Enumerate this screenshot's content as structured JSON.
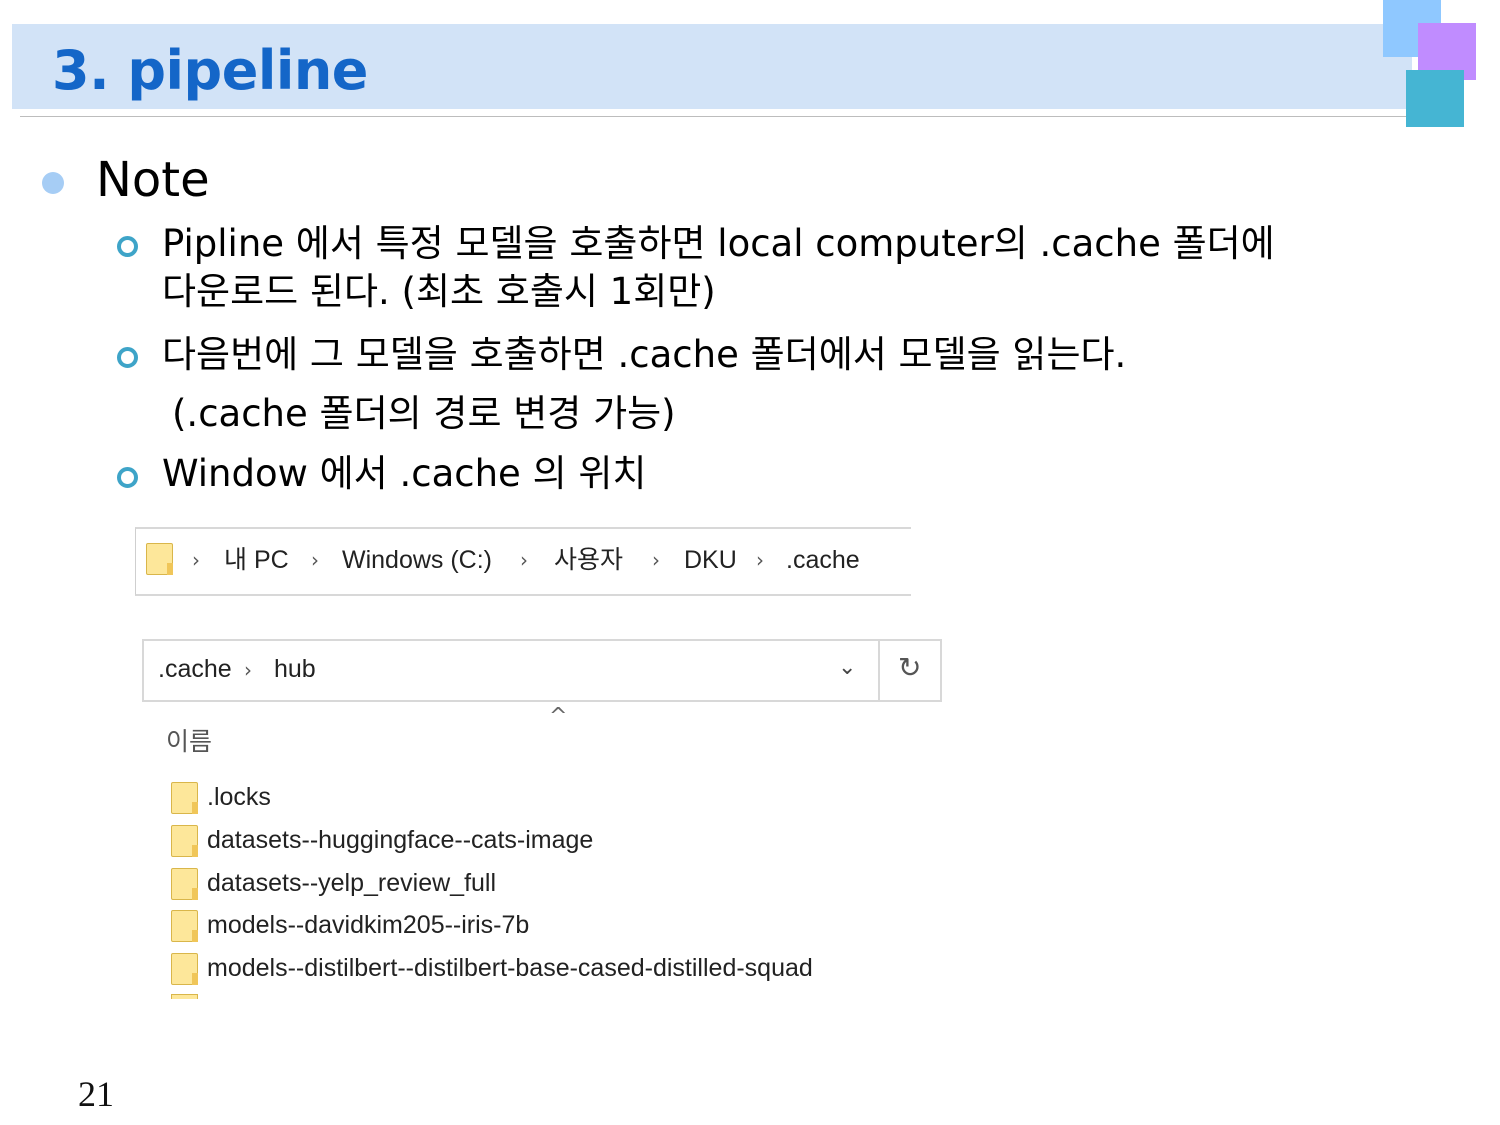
{
  "slide": {
    "title": "3. pipeline",
    "page_number": "21"
  },
  "content": {
    "heading": "Note",
    "items": [
      {
        "line1": "Pipline 에서 특정 모델을 호출하면 local computer의 .cache 폴더에",
        "line2": "다운로드 된다. (최초 호출시 1회만)"
      },
      {
        "line1": "다음번에 그 모델을 호출하면 .cache 폴더에서 모델을 읽는다.",
        "line2": "(.cache 폴더의 경로 변경 가능)"
      },
      {
        "line1": "Window 에서 .cache 의 위치"
      }
    ]
  },
  "breadcrumb": {
    "items": [
      "내 PC",
      "Windows (C:)",
      "사용자",
      "DKU",
      ".cache"
    ]
  },
  "address_bar": {
    "items": [
      ".cache",
      "hub"
    ]
  },
  "file_list": {
    "column_header": "이름",
    "files": [
      ".locks",
      "datasets--huggingface--cats-image",
      "datasets--yelp_review_full",
      "models--davidkim205--iris-7b",
      "models--distilbert--distilbert-base-cased-distilled-squad"
    ]
  },
  "colors": {
    "title": "#1466c8",
    "title_band": "#d2e3f7",
    "bullet_main": "#a6cdf5",
    "bullet_sub": "#3ea4c8"
  }
}
